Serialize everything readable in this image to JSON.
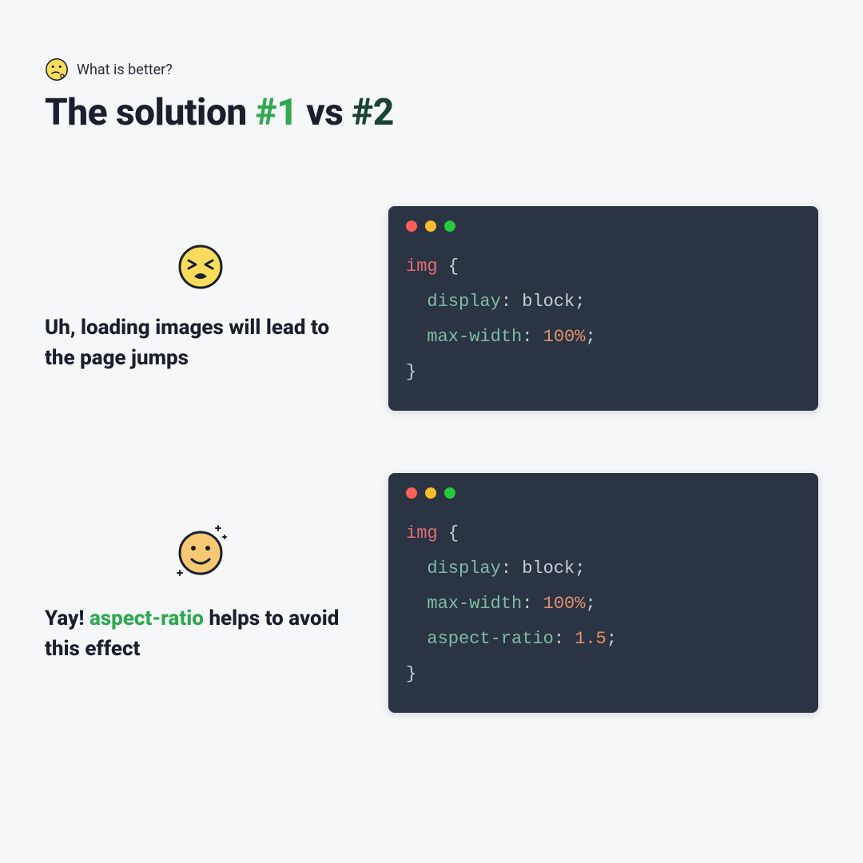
{
  "eyebrow": {
    "text": "What is better?"
  },
  "title": {
    "part1": "The solution ",
    "num1": "#1",
    "sep": "  vs ",
    "num2": "#2"
  },
  "section1": {
    "caption": "Uh, loading images will lead to the page jumps",
    "code": {
      "selector": "img",
      "props": [
        {
          "name": "display",
          "value": "block",
          "num": false
        },
        {
          "name": "max-width",
          "value": "100%",
          "num": true
        }
      ]
    }
  },
  "section2": {
    "caption_pre": "Yay!  ",
    "caption_accent": "aspect-ratio",
    "caption_post": " helps to avoid this effect",
    "code": {
      "selector": "img",
      "props": [
        {
          "name": "display",
          "value": "block",
          "num": false
        },
        {
          "name": "max-width",
          "value": "100%",
          "num": true
        },
        {
          "name": "aspect-ratio",
          "value": "1.5",
          "num": true
        }
      ]
    }
  }
}
